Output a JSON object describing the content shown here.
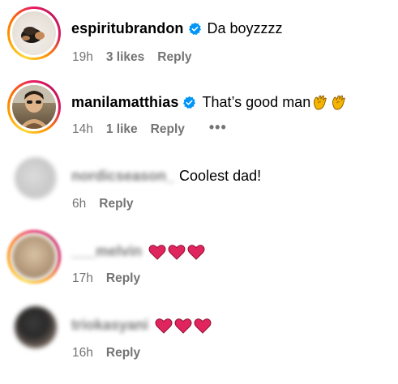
{
  "comments": [
    {
      "username": "espiritubrandon",
      "verified": true,
      "text": "Da boyzzzz",
      "time": "19h",
      "likes": "3 likes",
      "reply": "Reply"
    },
    {
      "username": "manilamatthias",
      "verified": true,
      "text": "That’s good man",
      "emoji": [
        "clapping-hands",
        "clapping-hands"
      ],
      "time": "14h",
      "likes": "1 like",
      "reply": "Reply",
      "more": "•••"
    },
    {
      "username": "nordicseason_",
      "verified": false,
      "text": "Coolest dad!",
      "time": "6h",
      "reply": "Reply"
    },
    {
      "username": "___melvin",
      "verified": false,
      "text": "",
      "emoji": [
        "red-heart",
        "red-heart",
        "red-heart"
      ],
      "time": "17h",
      "reply": "Reply"
    },
    {
      "username": "triokasyani",
      "verified": false,
      "text": "",
      "emoji": [
        "red-heart",
        "red-heart",
        "red-heart"
      ],
      "time": "16h",
      "reply": "Reply"
    }
  ],
  "colors": {
    "verified_badge": "#0095f6",
    "meta_text": "#737373",
    "heart": "#e0245e",
    "clap": "#f5b400"
  }
}
